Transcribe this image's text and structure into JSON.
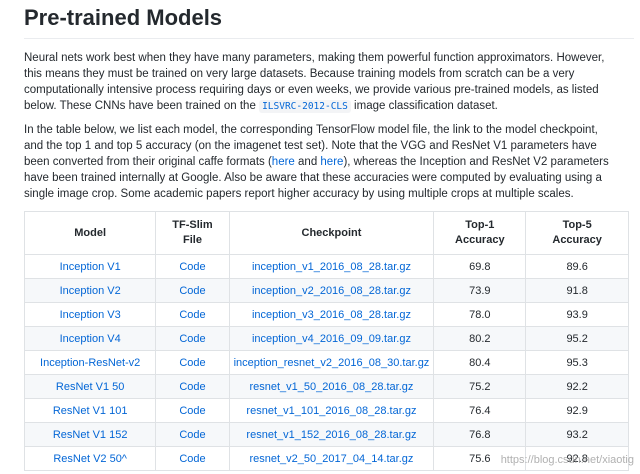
{
  "title": "Pre-trained Models",
  "para1": {
    "before": "Neural nets work best when they have many parameters, making them powerful function approximators. However, this means they must be trained on very large datasets. Because training models from scratch can be a very computationally intensive process requiring days or even weeks, we provide various pre-trained models, as listed below. These CNNs have been trained on the ",
    "dataset_link": "ILSVRC-2012-CLS",
    "after": " image classification dataset."
  },
  "para2": {
    "part1": "In the table below, we list each model, the corresponding TensorFlow model file, the link to the model checkpoint, and the top 1 and top 5 accuracy (on the imagenet test set). Note that the VGG and ResNet V1 parameters have been converted from their original caffe formats (",
    "link1": "here",
    "part2": " and ",
    "link2": "here",
    "part3": "), whereas the Inception and ResNet V2 parameters have been trained internally at Google. Also be aware that these accuracies were computed by evaluating using a single image crop. Some academic papers report higher accuracy by using multiple crops at multiple scales."
  },
  "table": {
    "headers": [
      "Model",
      "TF-Slim File",
      "Checkpoint",
      "Top-1 Accuracy",
      "Top-5 Accuracy"
    ],
    "rows": [
      {
        "model": "Inception V1",
        "file": "Code",
        "checkpoint": "inception_v1_2016_08_28.tar.gz",
        "top1": "69.8",
        "top5": "89.6"
      },
      {
        "model": "Inception V2",
        "file": "Code",
        "checkpoint": "inception_v2_2016_08_28.tar.gz",
        "top1": "73.9",
        "top5": "91.8"
      },
      {
        "model": "Inception V3",
        "file": "Code",
        "checkpoint": "inception_v3_2016_08_28.tar.gz",
        "top1": "78.0",
        "top5": "93.9"
      },
      {
        "model": "Inception V4",
        "file": "Code",
        "checkpoint": "inception_v4_2016_09_09.tar.gz",
        "top1": "80.2",
        "top5": "95.2"
      },
      {
        "model": "Inception-ResNet-v2",
        "file": "Code",
        "checkpoint": "inception_resnet_v2_2016_08_30.tar.gz",
        "top1": "80.4",
        "top5": "95.3"
      },
      {
        "model": "ResNet V1 50",
        "file": "Code",
        "checkpoint": "resnet_v1_50_2016_08_28.tar.gz",
        "top1": "75.2",
        "top5": "92.2"
      },
      {
        "model": "ResNet V1 101",
        "file": "Code",
        "checkpoint": "resnet_v1_101_2016_08_28.tar.gz",
        "top1": "76.4",
        "top5": "92.9"
      },
      {
        "model": "ResNet V1 152",
        "file": "Code",
        "checkpoint": "resnet_v1_152_2016_08_28.tar.gz",
        "top1": "76.8",
        "top5": "93.2"
      },
      {
        "model": "ResNet V2 50^",
        "file": "Code",
        "checkpoint": "resnet_v2_50_2017_04_14.tar.gz",
        "top1": "75.6",
        "top5": "92.8"
      }
    ]
  },
  "watermark": "https://blog.csdn.net/xiaotig",
  "colors": {
    "link": "#0366d6",
    "text": "#24292e",
    "border": "#dfe2e5",
    "stripe": "#f6f8fa"
  }
}
